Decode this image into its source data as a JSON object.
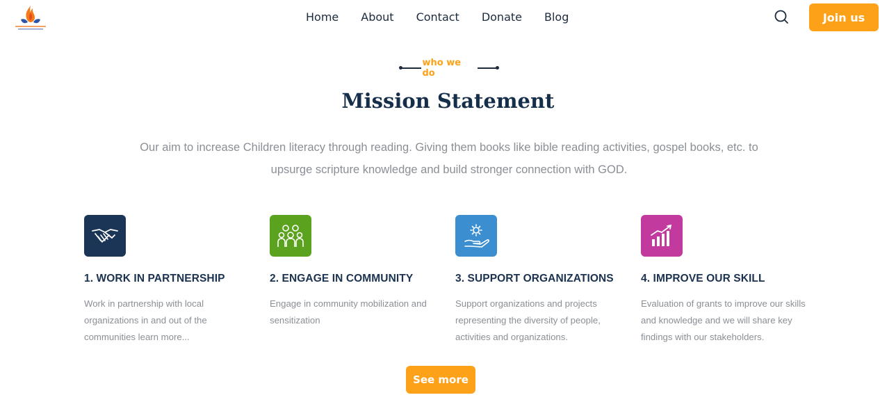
{
  "header": {
    "logo_icon": "flame-hands-logo",
    "nav": [
      "Home",
      "About",
      "Contact",
      "Donate",
      "Blog"
    ],
    "search_icon": "search-icon",
    "join_label": "Join us"
  },
  "section": {
    "eyebrow": "who we do",
    "title": "Mission Statement",
    "lead": "Our aim to increase Children literacy through reading. Giving them books like bible reading activities, gospel books, etc. to upsurge scripture knowledge and build stronger connection with GOD."
  },
  "features": [
    {
      "icon": "handshake-icon",
      "color": "#1a3555",
      "title": "1. WORK IN PARTNERSHIP",
      "text": "Work in partnership with local organizations in and out of the communities learn more..."
    },
    {
      "icon": "community-group-icon",
      "color": "#5ba21e",
      "title": "2. ENGAGE IN COMMUNITY",
      "text": "Engage in community mobilization and sensitization"
    },
    {
      "icon": "hand-gear-icon",
      "color": "#3b8fd1",
      "title": "3. SUPPORT ORGANIZATIONS",
      "text": "Support organizations and projects representing the diversity of people, activities and organizations."
    },
    {
      "icon": "growth-chart-icon",
      "color": "#c23a9e",
      "title": "4. IMPROVE OUR SKILL",
      "text": "Evaluation of grants to improve our skills and knowledge and we will share key findings with our stakeholders."
    }
  ],
  "cta": {
    "label": "See more"
  },
  "colors": {
    "accent": "#fca118",
    "heading": "#152e4a",
    "muted": "#8a8f96"
  }
}
